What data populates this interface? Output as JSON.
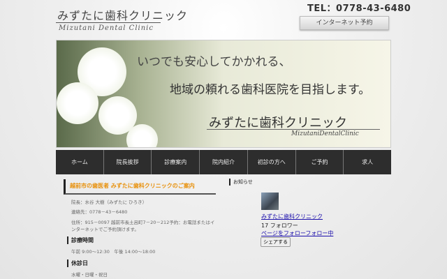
{
  "header": {
    "logo_jp": "みずたに歯科クリニック",
    "logo_en": "Mizutani Dental Clinic",
    "tel": "TEL：0778-43-6480",
    "reserve_button": "インターネット予約"
  },
  "banner": {
    "line1": "いつでも安心してかかれる、",
    "line2": "地域の頼れる歯科医院を目指します。",
    "clinic_name": "みずたに歯科クリニック",
    "clinic_en": "MizutaniDentalClinic"
  },
  "nav": [
    "ホーム",
    "院長挨拶",
    "診療案内",
    "院内紹介",
    "初診の方へ",
    "ご予約",
    "求人"
  ],
  "main": {
    "heading": "越前市の歯医者 みずたに歯科クリニックのご案内",
    "director": "院長：水谷 大樹（みずたに ひろき）",
    "contact": "連絡先：0778－43－6480",
    "address": "住所：915－0097 越前市長土呂町7－20－212予約：お電話またはインターネットでご予約頂けます。",
    "hours_heading": "診療時間",
    "hours": "午前 9:00～12:30　午後 14:00～18:00",
    "closed_heading": "休診日",
    "closed": "水曜・日曜・祝日"
  },
  "news": {
    "heading": "お知らせ",
    "fb_name": "みずたに歯科クリニック",
    "followers": "17 フォロワー",
    "follow": "ページをフォローフォロー中",
    "share": "シェアする"
  }
}
